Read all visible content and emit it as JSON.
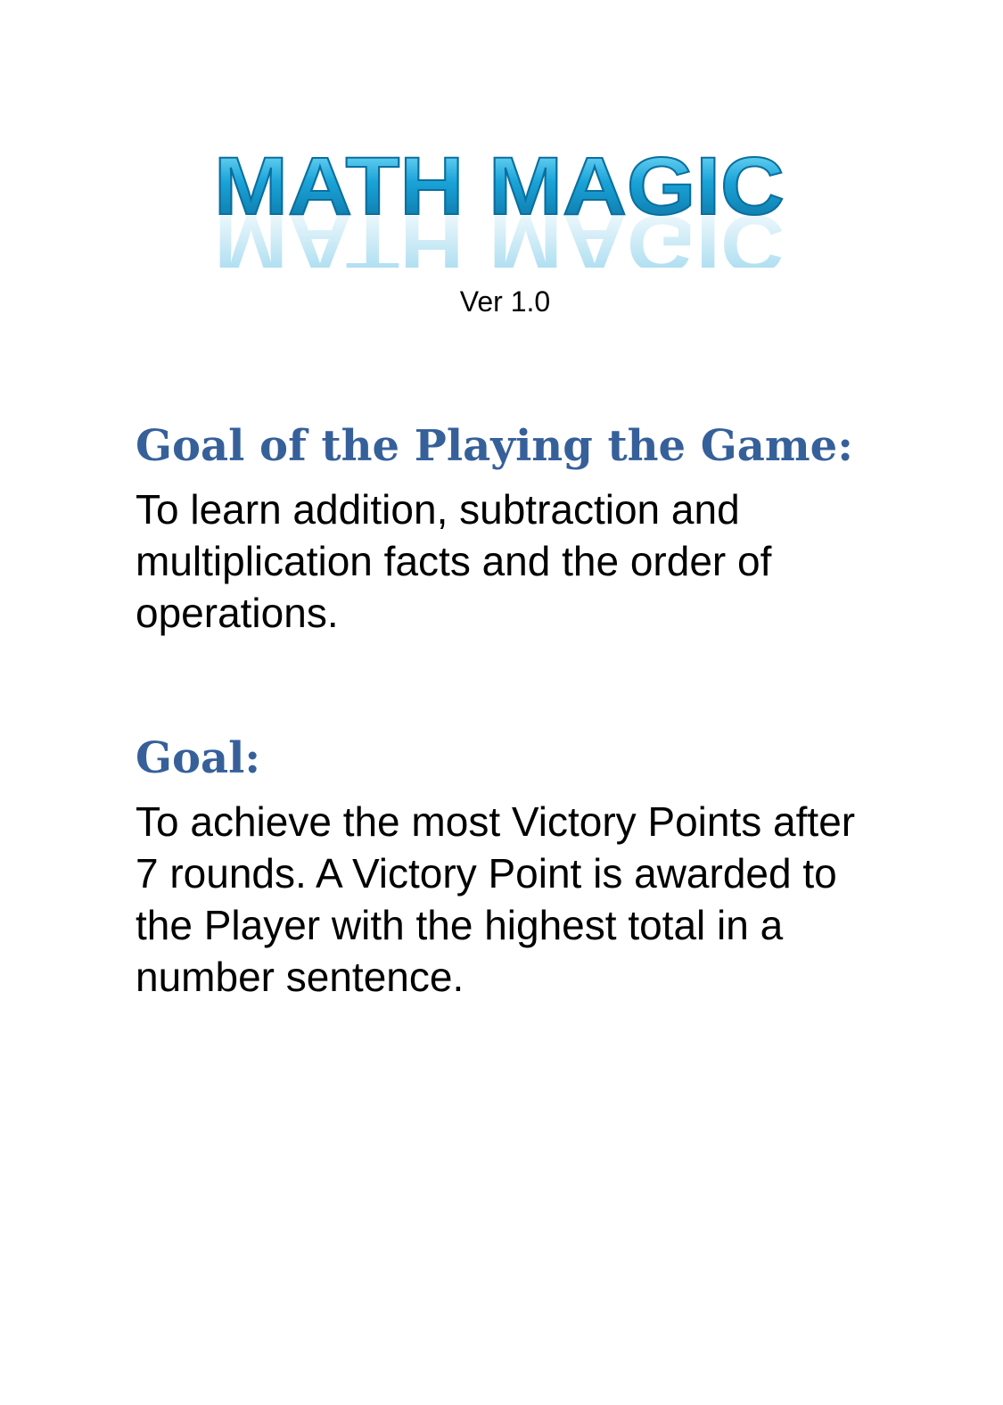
{
  "document": {
    "logo_text": "MATH MAGIC",
    "version": "Ver 1.0",
    "sections": [
      {
        "heading": "Goal of the Playing the Game:",
        "body": "To learn addition, subtraction and multiplication facts and the order of operations."
      },
      {
        "heading": "Goal:",
        "body": "To achieve the most Victory Points after 7 rounds. A Victory Point is awarded to the Player with the highest total in a number sentence."
      }
    ]
  },
  "colors": {
    "logo_light": "#5fd3f5",
    "logo_mid": "#1aa3d8",
    "logo_dark": "#0b6f9e",
    "heading": "#36609a"
  }
}
